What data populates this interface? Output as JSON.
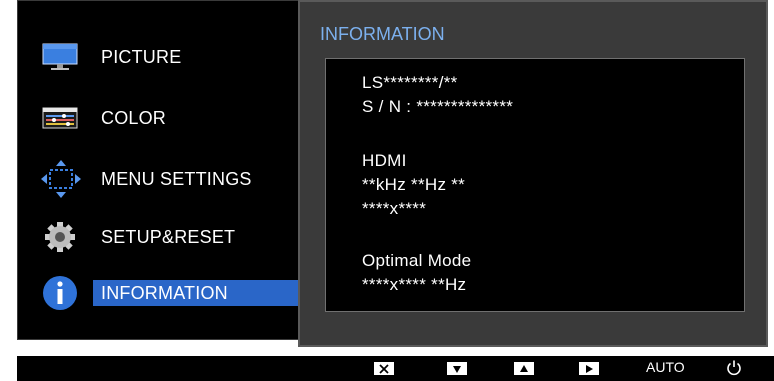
{
  "menu": {
    "items": [
      {
        "label": "PICTURE",
        "icon": "monitor-icon",
        "selected": false
      },
      {
        "label": "COLOR",
        "icon": "color-sliders-icon",
        "selected": false
      },
      {
        "label": "MENU SETTINGS",
        "icon": "arrows-move-icon",
        "selected": false
      },
      {
        "label": "SETUP&RESET",
        "icon": "gear-icon",
        "selected": false
      },
      {
        "label": "INFORMATION",
        "icon": "info-icon",
        "selected": true
      }
    ]
  },
  "info": {
    "title": "INFORMATION",
    "model": "LS********/**",
    "serial": "S / N : **************",
    "input": "HDMI",
    "frequency": "**kHz **Hz **",
    "resolution": "****x****",
    "optimal_mode_label": "Optimal Mode",
    "optimal_mode_value": "****x**** **Hz"
  },
  "keys": {
    "close_icon": "close-icon",
    "down_icon": "down-arrow-icon",
    "up_icon": "up-arrow-icon",
    "right_icon": "right-arrow-icon",
    "auto_label": "AUTO",
    "power_icon": "power-icon"
  },
  "colors": {
    "accent": "#7cb0ee",
    "selected_bg": "#2a66c8",
    "panel_bg": "#3a3a3a"
  }
}
